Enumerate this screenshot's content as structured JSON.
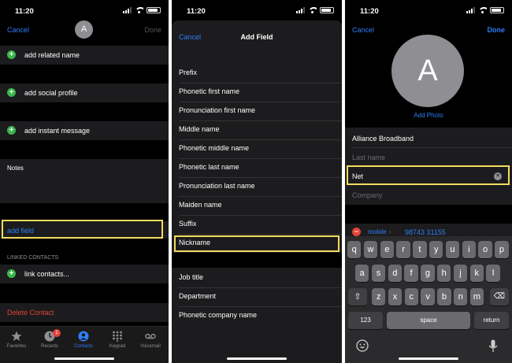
{
  "status": {
    "time": "11:20"
  },
  "panel1": {
    "cancel": "Cancel",
    "avatar_letter": "A",
    "done": "Done",
    "add_related_name": "add related name",
    "add_social_profile": "add social profile",
    "add_instant_message": "add instant message",
    "notes_label": "Notes",
    "add_field": "add field",
    "linked_contacts": "LINKED CONTACTS",
    "link_contacts": "link contacts...",
    "delete_contact": "Delete Contact",
    "tabs": [
      {
        "label": "Favorites",
        "icon": "star-icon"
      },
      {
        "label": "Recents",
        "icon": "clock-icon",
        "badge": "1"
      },
      {
        "label": "Contacts",
        "icon": "person-icon"
      },
      {
        "label": "Keypad",
        "icon": "keypad-icon"
      },
      {
        "label": "Voicemail",
        "icon": "voicemail-icon"
      }
    ]
  },
  "panel2": {
    "cancel": "Cancel",
    "title": "Add Field",
    "fields": [
      "Prefix",
      "Phonetic first name",
      "Pronunciation first name",
      "Middle name",
      "Phonetic middle name",
      "Phonetic last name",
      "Pronunciation last name",
      "Maiden name",
      "Suffix",
      "Nickname"
    ],
    "fields2": [
      "Job title",
      "Department",
      "Phonetic company name"
    ]
  },
  "panel3": {
    "cancel": "Cancel",
    "done": "Done",
    "avatar_letter": "A",
    "add_photo": "Add Photo",
    "first_name": "Alliance Broadband",
    "last_name_placeholder": "Last name",
    "nickname_value": "Net",
    "company_placeholder": "Company",
    "phone_label": "mobile",
    "phone_number": "98743 31155",
    "keyboard": {
      "row1": [
        "q",
        "w",
        "e",
        "r",
        "t",
        "y",
        "u",
        "i",
        "o",
        "p"
      ],
      "row2": [
        "a",
        "s",
        "d",
        "f",
        "g",
        "h",
        "j",
        "k",
        "l"
      ],
      "row3": [
        "z",
        "x",
        "c",
        "v",
        "b",
        "n",
        "m"
      ],
      "num": "123",
      "space": "space",
      "return": "return"
    }
  },
  "colors": {
    "accent": "#2f7ff7",
    "highlight": "#f2dc5d",
    "green": "#3bb54a",
    "red": "#e0443a"
  }
}
